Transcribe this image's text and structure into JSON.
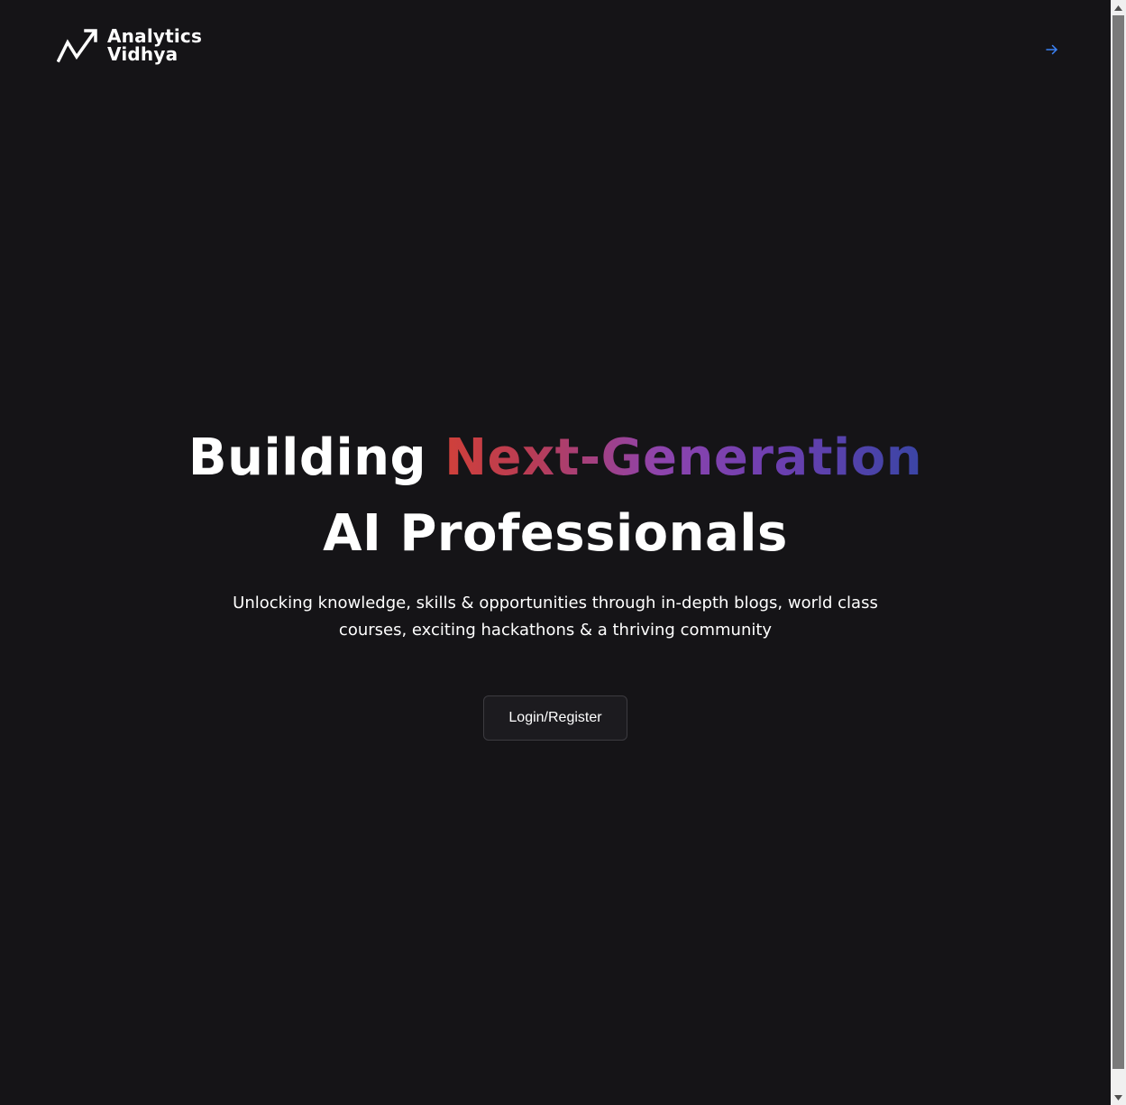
{
  "header": {
    "logo_line1": "Analytics",
    "logo_line2": "Vidhya",
    "arrow_icon": "arrow-right-icon",
    "arrow_color": "#3b82f6"
  },
  "hero": {
    "title_part1": "Building ",
    "title_highlight": "Next-Generation",
    "title_line2": "AI Professionals",
    "subtitle": "Unlocking knowledge, skills & opportunities through in-depth blogs, world class courses, exciting hackathons & a thriving community",
    "cta_label": "Login/Register"
  },
  "colors": {
    "background": "#151417",
    "gradient_start": "#d0403a",
    "gradient_mid": "#8e44ad",
    "gradient_end": "#3a45a5"
  }
}
